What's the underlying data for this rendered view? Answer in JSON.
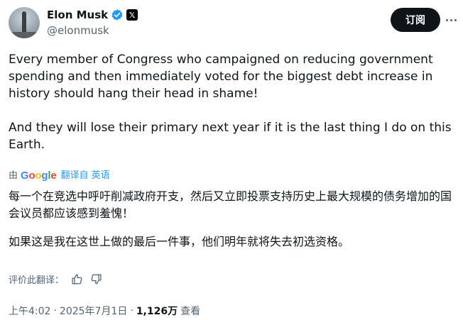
{
  "author": {
    "name": "Elon Musk",
    "handle": "@elonmusk",
    "x_badge": "𝕏",
    "verified_color": "#1d9bf0"
  },
  "actions": {
    "subscribe_label": "订阅",
    "more_icon": "more-icon"
  },
  "post": {
    "paragraph_1": "Every member of Congress who campaigned on reducing government spending and then immediately voted for the biggest debt increase in history should hang their head in shame!",
    "paragraph_2": "And they will lose their primary next year if it is the last thing I do on this Earth."
  },
  "translation": {
    "by_label": "由",
    "provider": "Google",
    "link_text": "翻译自 英语",
    "paragraph_1": "每一个在竞选中呼吁削减政府开支，然后又立即投票支持历史上最大规模的债务增加的国会议员都应该感到羞愧！",
    "paragraph_2": "如果这是我在这世上做的最后一件事，他们明年就将失去初选资格。",
    "rate_label": "评价此翻译："
  },
  "meta": {
    "time": "上午4:02",
    "date": "2025年7月1日",
    "separator": "·",
    "views_count": "1,126万",
    "views_label": "查看"
  }
}
